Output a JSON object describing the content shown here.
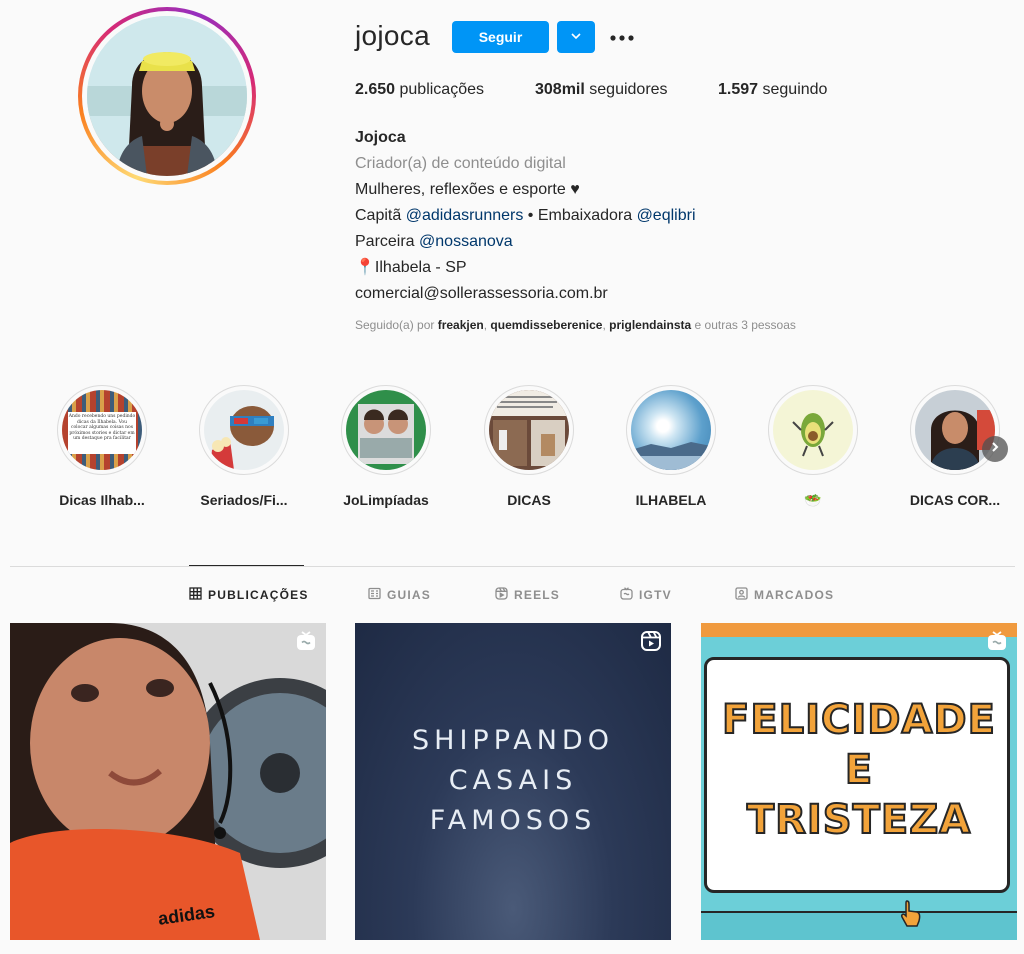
{
  "profile": {
    "username": "jojoca",
    "follow_label": "Seguir",
    "stats": {
      "posts_count": "2.650",
      "posts_label": "publicações",
      "followers_count": "308mil",
      "followers_label": "seguidores",
      "following_count": "1.597",
      "following_label": "seguindo"
    },
    "bio": {
      "name": "Jojoca",
      "category": "Criador(a) de conteúdo digital",
      "line1": "Mulheres, reflexões e esporte ♥",
      "line2_a": "Capitã ",
      "line2_link1": "@adidasrunners",
      "line2_b": " • Embaixadora ",
      "line2_link2": "@eqlibri",
      "line3_a": "Parceira ",
      "line3_link": "@nossanova",
      "line4": "📍Ilhabela - SP",
      "line5": "comercial@sollerassessoria.com.br"
    },
    "followed_by": {
      "prefix": "Seguido(a) por ",
      "user1": "freakjen",
      "user2": "quemdisseberenice",
      "user3": "priglendainsta",
      "suffix": " e outras 3 pessoas"
    }
  },
  "highlights": [
    {
      "label": "Dicas Ilhab...",
      "image_text": "Ando recebendo uns pedindo dicas da Ilhabela. Vou colocar algumas coisas nos próximos stories e dictar em um destaque pra facilitar"
    },
    {
      "label": "Seriados/Fi..."
    },
    {
      "label": "JoLimpíadas"
    },
    {
      "label": "DICAS"
    },
    {
      "label": "ILHABELA"
    },
    {
      "label": "🥗"
    },
    {
      "label": "DICAS COR..."
    }
  ],
  "tabs": [
    {
      "label": "PUBLICAÇÕES",
      "icon": "grid-icon",
      "active": true
    },
    {
      "label": "GUIAS",
      "icon": "guide-icon",
      "active": false
    },
    {
      "label": "REELS",
      "icon": "reels-icon",
      "active": false
    },
    {
      "label": "IGTV",
      "icon": "igtv-icon",
      "active": false
    },
    {
      "label": "MARCADOS",
      "icon": "tagged-icon",
      "active": false
    }
  ],
  "posts": [
    {
      "type": "igtv",
      "overlay_text": "adidas"
    },
    {
      "type": "reel",
      "line1": "SHIPPANDO",
      "line2": "CASAIS",
      "line3": "FAMOSOS"
    },
    {
      "type": "igtv",
      "line1": "FELICIDADE",
      "line2": "E",
      "line3": "TRISTEZA"
    }
  ],
  "colors": {
    "accent": "#0095f6",
    "link": "#00376b",
    "muted": "#8e8e8e",
    "text": "#262626"
  }
}
